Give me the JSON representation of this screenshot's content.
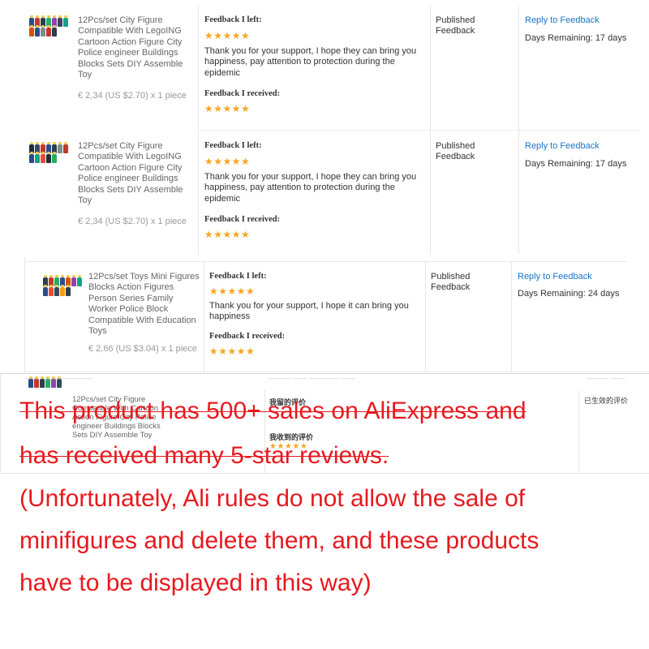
{
  "rows": [
    {
      "product": "12Pcs/set City Figure Compatible With LegoING Cartoon Action Figure City Police engineer Buildings Blocks Sets DIY Assemble Toy",
      "price": "€ 2,34 (US $2.70) x 1 piece",
      "left_label": "Feedback I left:",
      "left_stars": "★★★★★",
      "left_text": "Thank you for your support, I hope they can bring you happiness, pay attention to protection during the epidemic",
      "received_label": "Feedback I received:",
      "received_stars": "★★★★★",
      "status": "Published Feedback",
      "reply": "Reply to Feedback",
      "days": "Days Remaining: 17 days"
    },
    {
      "product": "12Pcs/set City Figure Compatible With LegoING Cartoon Action Figure City Police engineer Buildings Blocks Sets DIY Assemble Toy",
      "price": "€ 2,34 (US $2.70) x 1 piece",
      "left_label": "Feedback I left:",
      "left_stars": "★★★★★",
      "left_text": "Thank you for your support, I hope they can bring you happiness, pay attention to protection during the epidemic",
      "received_label": "Feedback I received:",
      "received_stars": "★★★★★",
      "status": "Published Feedback",
      "reply": "Reply to Feedback",
      "days": "Days Remaining: 17 days"
    },
    {
      "product": "12Pcs/set Toys Mini Figures Blocks Action Figures Person Series Family Worker Police Block Compatible With Education Toys",
      "price": "€ 2,66 (US $3.04) x 1 piece",
      "left_label": "Feedback I left:",
      "left_stars": "★★★★★",
      "left_text": "Thank you for your support, I hope it can bring you happiness",
      "received_label": "Feedback I received:",
      "received_stars": "★★★★★",
      "status": "Published Feedback",
      "reply": "Reply to Feedback",
      "days": "Days Remaining: 24 days"
    }
  ],
  "cn_row": {
    "product": "12Pcs/set City Figure Compatible With Cartoon Action Figure City Police engineer Buildings Blocks Sets DIY Assemble Toy",
    "left_label": "我留的评价",
    "received_label": "我收到的评价",
    "received_stars": "★★★★★",
    "status": "已生效的评价"
  },
  "overlay": {
    "line1": "This product has 500+ sales on AliExpress and",
    "line2": "has received many 5-star reviews.",
    "line3": " (Unfortunately, Ali rules do not allow the sale of",
    "line4": "minifigures and delete them, and these products",
    "line5": "have to be displayed in this way)"
  },
  "colors": {
    "star": "#f5a623",
    "link": "#1a73c8",
    "overlay_text": "#e6191f"
  }
}
